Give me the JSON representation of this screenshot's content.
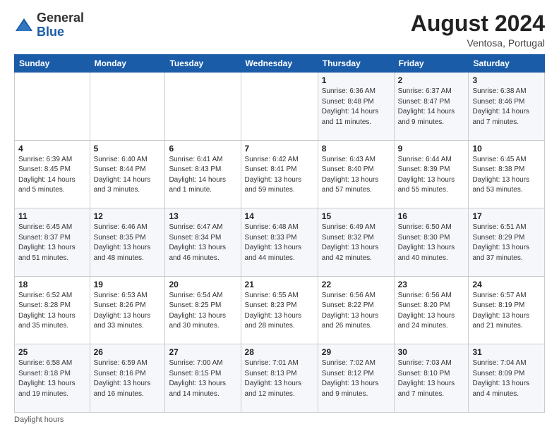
{
  "header": {
    "logo_general": "General",
    "logo_blue": "Blue",
    "month_year": "August 2024",
    "location": "Ventosa, Portugal"
  },
  "footer": {
    "note": "Daylight hours"
  },
  "weekdays": [
    "Sunday",
    "Monday",
    "Tuesday",
    "Wednesday",
    "Thursday",
    "Friday",
    "Saturday"
  ],
  "weeks": [
    [
      {
        "day": "",
        "info": ""
      },
      {
        "day": "",
        "info": ""
      },
      {
        "day": "",
        "info": ""
      },
      {
        "day": "",
        "info": ""
      },
      {
        "day": "1",
        "info": "Sunrise: 6:36 AM\nSunset: 8:48 PM\nDaylight: 14 hours and 11 minutes."
      },
      {
        "day": "2",
        "info": "Sunrise: 6:37 AM\nSunset: 8:47 PM\nDaylight: 14 hours and 9 minutes."
      },
      {
        "day": "3",
        "info": "Sunrise: 6:38 AM\nSunset: 8:46 PM\nDaylight: 14 hours and 7 minutes."
      }
    ],
    [
      {
        "day": "4",
        "info": "Sunrise: 6:39 AM\nSunset: 8:45 PM\nDaylight: 14 hours and 5 minutes."
      },
      {
        "day": "5",
        "info": "Sunrise: 6:40 AM\nSunset: 8:44 PM\nDaylight: 14 hours and 3 minutes."
      },
      {
        "day": "6",
        "info": "Sunrise: 6:41 AM\nSunset: 8:43 PM\nDaylight: 14 hours and 1 minute."
      },
      {
        "day": "7",
        "info": "Sunrise: 6:42 AM\nSunset: 8:41 PM\nDaylight: 13 hours and 59 minutes."
      },
      {
        "day": "8",
        "info": "Sunrise: 6:43 AM\nSunset: 8:40 PM\nDaylight: 13 hours and 57 minutes."
      },
      {
        "day": "9",
        "info": "Sunrise: 6:44 AM\nSunset: 8:39 PM\nDaylight: 13 hours and 55 minutes."
      },
      {
        "day": "10",
        "info": "Sunrise: 6:45 AM\nSunset: 8:38 PM\nDaylight: 13 hours and 53 minutes."
      }
    ],
    [
      {
        "day": "11",
        "info": "Sunrise: 6:45 AM\nSunset: 8:37 PM\nDaylight: 13 hours and 51 minutes."
      },
      {
        "day": "12",
        "info": "Sunrise: 6:46 AM\nSunset: 8:35 PM\nDaylight: 13 hours and 48 minutes."
      },
      {
        "day": "13",
        "info": "Sunrise: 6:47 AM\nSunset: 8:34 PM\nDaylight: 13 hours and 46 minutes."
      },
      {
        "day": "14",
        "info": "Sunrise: 6:48 AM\nSunset: 8:33 PM\nDaylight: 13 hours and 44 minutes."
      },
      {
        "day": "15",
        "info": "Sunrise: 6:49 AM\nSunset: 8:32 PM\nDaylight: 13 hours and 42 minutes."
      },
      {
        "day": "16",
        "info": "Sunrise: 6:50 AM\nSunset: 8:30 PM\nDaylight: 13 hours and 40 minutes."
      },
      {
        "day": "17",
        "info": "Sunrise: 6:51 AM\nSunset: 8:29 PM\nDaylight: 13 hours and 37 minutes."
      }
    ],
    [
      {
        "day": "18",
        "info": "Sunrise: 6:52 AM\nSunset: 8:28 PM\nDaylight: 13 hours and 35 minutes."
      },
      {
        "day": "19",
        "info": "Sunrise: 6:53 AM\nSunset: 8:26 PM\nDaylight: 13 hours and 33 minutes."
      },
      {
        "day": "20",
        "info": "Sunrise: 6:54 AM\nSunset: 8:25 PM\nDaylight: 13 hours and 30 minutes."
      },
      {
        "day": "21",
        "info": "Sunrise: 6:55 AM\nSunset: 8:23 PM\nDaylight: 13 hours and 28 minutes."
      },
      {
        "day": "22",
        "info": "Sunrise: 6:56 AM\nSunset: 8:22 PM\nDaylight: 13 hours and 26 minutes."
      },
      {
        "day": "23",
        "info": "Sunrise: 6:56 AM\nSunset: 8:20 PM\nDaylight: 13 hours and 24 minutes."
      },
      {
        "day": "24",
        "info": "Sunrise: 6:57 AM\nSunset: 8:19 PM\nDaylight: 13 hours and 21 minutes."
      }
    ],
    [
      {
        "day": "25",
        "info": "Sunrise: 6:58 AM\nSunset: 8:18 PM\nDaylight: 13 hours and 19 minutes."
      },
      {
        "day": "26",
        "info": "Sunrise: 6:59 AM\nSunset: 8:16 PM\nDaylight: 13 hours and 16 minutes."
      },
      {
        "day": "27",
        "info": "Sunrise: 7:00 AM\nSunset: 8:15 PM\nDaylight: 13 hours and 14 minutes."
      },
      {
        "day": "28",
        "info": "Sunrise: 7:01 AM\nSunset: 8:13 PM\nDaylight: 13 hours and 12 minutes."
      },
      {
        "day": "29",
        "info": "Sunrise: 7:02 AM\nSunset: 8:12 PM\nDaylight: 13 hours and 9 minutes."
      },
      {
        "day": "30",
        "info": "Sunrise: 7:03 AM\nSunset: 8:10 PM\nDaylight: 13 hours and 7 minutes."
      },
      {
        "day": "31",
        "info": "Sunrise: 7:04 AM\nSunset: 8:09 PM\nDaylight: 13 hours and 4 minutes."
      }
    ]
  ]
}
